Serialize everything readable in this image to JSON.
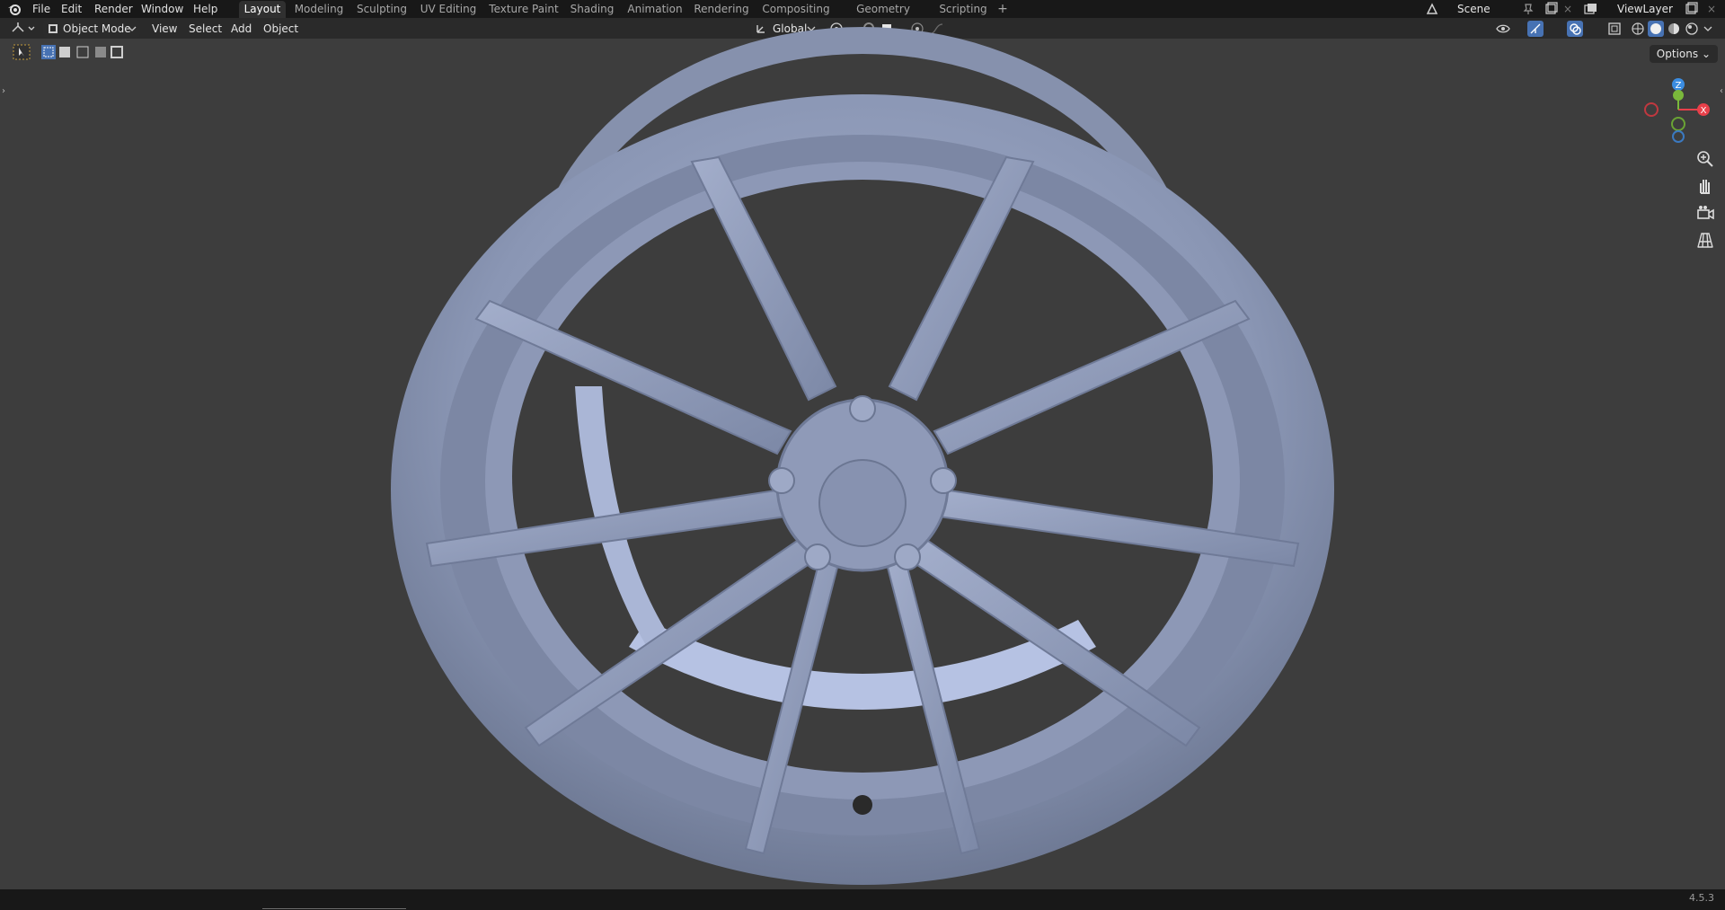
{
  "menu": {
    "file": "File",
    "edit": "Edit",
    "render": "Render",
    "window": "Window",
    "help": "Help"
  },
  "workspaces": [
    {
      "label": "Layout",
      "active": true
    },
    {
      "label": "Modeling",
      "active": false
    },
    {
      "label": "Sculpting",
      "active": false
    },
    {
      "label": "UV Editing",
      "active": false
    },
    {
      "label": "Texture Paint",
      "active": false
    },
    {
      "label": "Shading",
      "active": false
    },
    {
      "label": "Animation",
      "active": false
    },
    {
      "label": "Rendering",
      "active": false
    },
    {
      "label": "Compositing",
      "active": false
    },
    {
      "label": "Geometry Nodes",
      "active": false
    },
    {
      "label": "Scripting",
      "active": false
    }
  ],
  "add_workspace": "+",
  "scene": {
    "label": "Scene"
  },
  "view_layer": {
    "label": "ViewLayer"
  },
  "header": {
    "mode": "Object Mode",
    "view": "View",
    "select": "Select",
    "add": "Add",
    "object": "Object",
    "transform_orientation": "Global"
  },
  "viewport": {
    "options": "Options"
  },
  "gizmo": {
    "z": "Z",
    "x": "X"
  },
  "statusbar": {
    "version": "4.5.3"
  },
  "colors": {
    "x_axis": "#e8404a",
    "y_axis": "#7ab83b",
    "z_axis": "#3b8de2",
    "wheel": "#8b97b4",
    "accent": "#4772b3"
  },
  "icons": {
    "editor_type": "viewport-icon",
    "nav": [
      "zoom-icon",
      "hand-icon",
      "camera-icon",
      "grid-icon"
    ]
  }
}
